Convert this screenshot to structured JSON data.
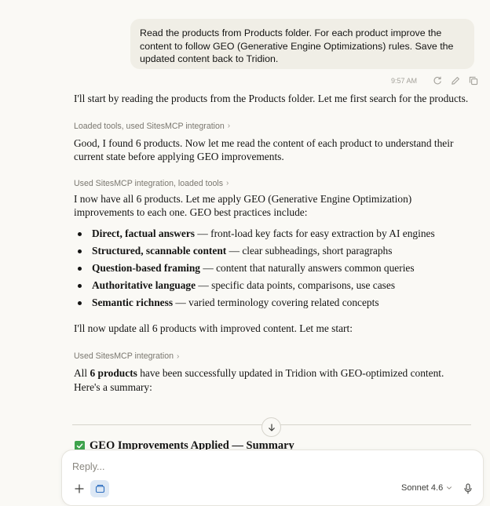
{
  "user_message": {
    "text": "Read the products from Products folder. For each product improve the content to follow GEO (Generative Engine Optimizations) rules. Save the updated content back to Tridion.",
    "time": "9:57 AM"
  },
  "assistant": {
    "p1": "I'll start by reading the products from the Products folder. Let me first search for the products.",
    "tool1": "Loaded tools, used SitesMCP integration",
    "p2": "Good, I found 6 products. Now let me read the content of each product to understand their current state before applying GEO improvements.",
    "tool2": "Used SitesMCP integration, loaded tools",
    "p3": "I now have all 6 products. Let me apply GEO (Generative Engine Optimization) improvements to each one. GEO best practices include:",
    "bullets": [
      {
        "bold": "Direct, factual answers",
        "rest": " — front-load key facts for easy extraction by AI engines"
      },
      {
        "bold": "Structured, scannable content",
        "rest": " — clear subheadings, short paragraphs"
      },
      {
        "bold": "Question-based framing",
        "rest": " — content that naturally answers common queries"
      },
      {
        "bold": "Authoritative language",
        "rest": " — specific data points, comparisons, use cases"
      },
      {
        "bold": "Semantic richness",
        "rest": " — varied terminology covering related concepts"
      }
    ],
    "p4": "I'll now update all 6 products with improved content. Let me start:",
    "tool3": "Used SitesMCP integration",
    "p5_pre": "All ",
    "p5_bold": "6 products",
    "p5_post": " have been successfully updated in Tridion with GEO-optimized content. Here's a summary:",
    "summary_heading": "GEO Improvements Applied — Summary"
  },
  "composer": {
    "placeholder": "Reply...",
    "model": "Sonnet 4.6"
  },
  "icons": {
    "retry": "retry-icon",
    "edit": "edit-icon",
    "copy": "copy-icon",
    "scroll": "arrow-down-icon",
    "check": "check-icon",
    "plus": "plus-icon",
    "tools": "tools-icon",
    "model_chevron": "chevron-down-icon",
    "mic": "mic-icon"
  },
  "colors": {
    "background": "#faf9f5",
    "bubble": "#f0eee6",
    "check_green": "#3fa34d",
    "tools_button": "#dde8f5"
  }
}
